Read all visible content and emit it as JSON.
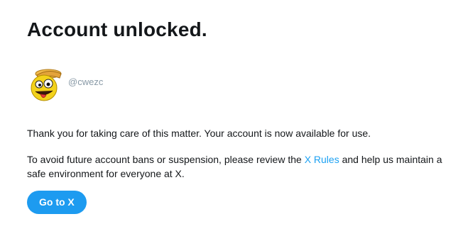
{
  "header": {
    "title": "Account unlocked."
  },
  "profile": {
    "handle": "@cwezc",
    "avatar_icon": "smiley-face-icon"
  },
  "body": {
    "line1": "Thank you for taking care of this matter. Your account is now available for use.",
    "line2_before": "To avoid future account bans or suspension, please review the ",
    "rules_link": "X Rules",
    "line2_after": " and help us maintain a safe environment for everyone at X."
  },
  "actions": {
    "primary_label": "Go to X"
  },
  "colors": {
    "accent": "#1d9bf0",
    "link": "#1da1f2",
    "text": "#14171a",
    "muted": "#8899a6"
  }
}
